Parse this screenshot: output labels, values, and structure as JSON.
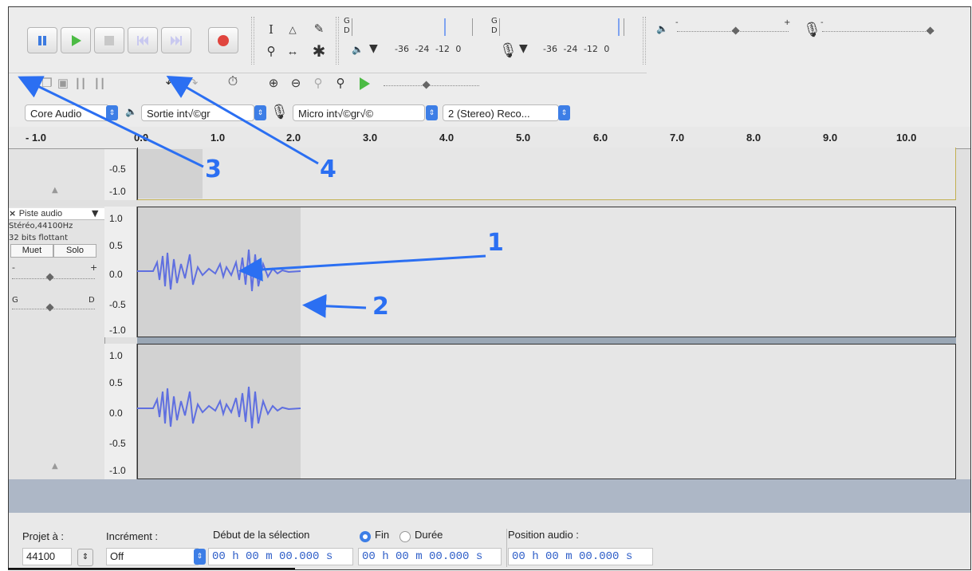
{
  "toolbar": {
    "transport": [
      "pause",
      "play",
      "stop",
      "skip-start",
      "skip-end",
      "record"
    ],
    "meter_scale_play": [
      "-36",
      "-24",
      "-12",
      "0"
    ],
    "meter_scale_rec": [
      "-36",
      "-24",
      "-12",
      "0"
    ],
    "meter_channels": [
      "G",
      "D"
    ],
    "vol_min": "-",
    "vol_max": "+"
  },
  "device": {
    "host": "Core Audio",
    "output": "Sortie int√©gr",
    "input": "Micro int√©gr√©",
    "channels": "2 (Stereo) Reco..."
  },
  "ruler": {
    "labels": [
      "- 1.0",
      "0.0",
      "1.0",
      "2.0",
      "3.0",
      "4.0",
      "5.0",
      "6.0",
      "7.0",
      "8.0",
      "9.0",
      "10.0"
    ]
  },
  "track0": {
    "scale": [
      "-0.5",
      "-1.0"
    ]
  },
  "track": {
    "name": "Piste audio",
    "close": "×",
    "format": "Stéréo,44100Hz",
    "bits": "32 bits flottant",
    "mute": "Muet",
    "solo": "Solo",
    "gain_min": "-",
    "gain_max": "+",
    "pan_left": "G",
    "pan_right": "D",
    "scale": [
      "1.0",
      "0.5",
      "0.0",
      "-0.5",
      "-1.0"
    ]
  },
  "bottom": {
    "project_rate_label": "Projet à :",
    "project_rate_value": "44100",
    "snap_label": "Incrément :",
    "snap_value": "Off",
    "selection_start_label": "Début de la sélection",
    "end_label": "Fin",
    "length_label": "Durée",
    "audio_position_label": "Position audio :",
    "time_start": "00 h 00 m 00.000 s",
    "time_end": "00 h 00 m 00.000 s",
    "time_position": "00 h 00 m 00.000 s"
  },
  "annotations": [
    "1",
    "2",
    "3",
    "4"
  ],
  "colors": {
    "accent": "#2b6ff2",
    "wave": "#5f6fe0",
    "record": "#e0453e",
    "play": "#4cbb44"
  }
}
